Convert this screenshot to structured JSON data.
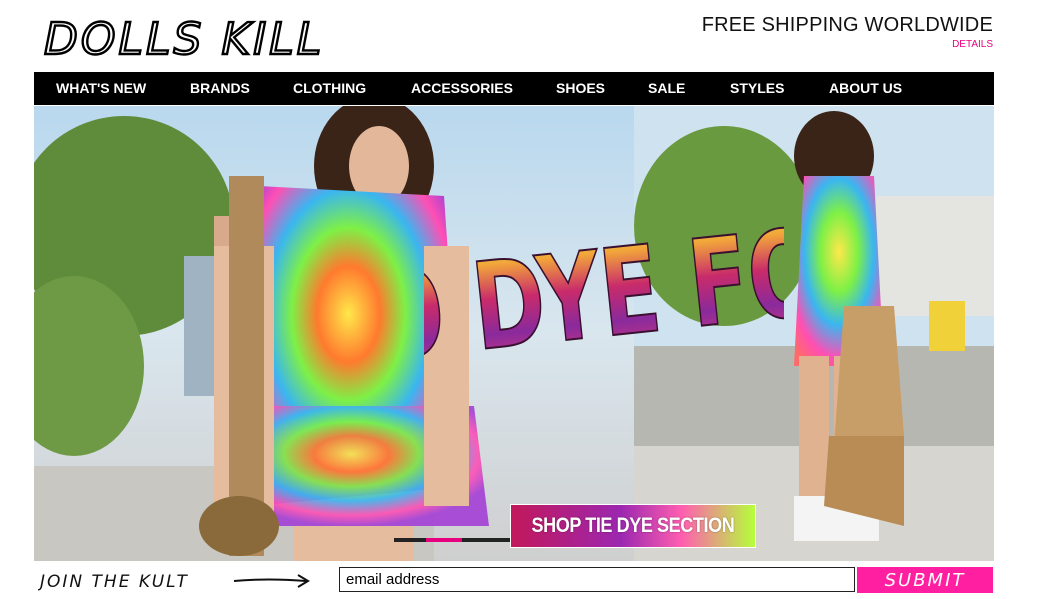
{
  "header": {
    "logo_text": "DOLLS KILL",
    "promo_title": "FREE SHIPPING WORLDWIDE",
    "promo_link": "DETAILS"
  },
  "nav": {
    "items": [
      {
        "label": "WHAT'S NEW"
      },
      {
        "label": "BRANDS"
      },
      {
        "label": "CLOTHING"
      },
      {
        "label": "ACCESSORIES"
      },
      {
        "label": "SHOES"
      },
      {
        "label": "SALE"
      },
      {
        "label": "STYLES"
      },
      {
        "label": "ABOUT US"
      }
    ]
  },
  "hero": {
    "headline": "TO DYE FOR",
    "cta_label": "SHOP TIE DYE SECTION",
    "slider_progress": 0.2
  },
  "signup": {
    "join_text": "JOIN THE KULT",
    "email_value": "email address",
    "submit_label": "SUBMIT"
  },
  "colors": {
    "accent": "#e6007e",
    "submit_bg": "#ff1fa0",
    "nav_bg": "#000000"
  }
}
